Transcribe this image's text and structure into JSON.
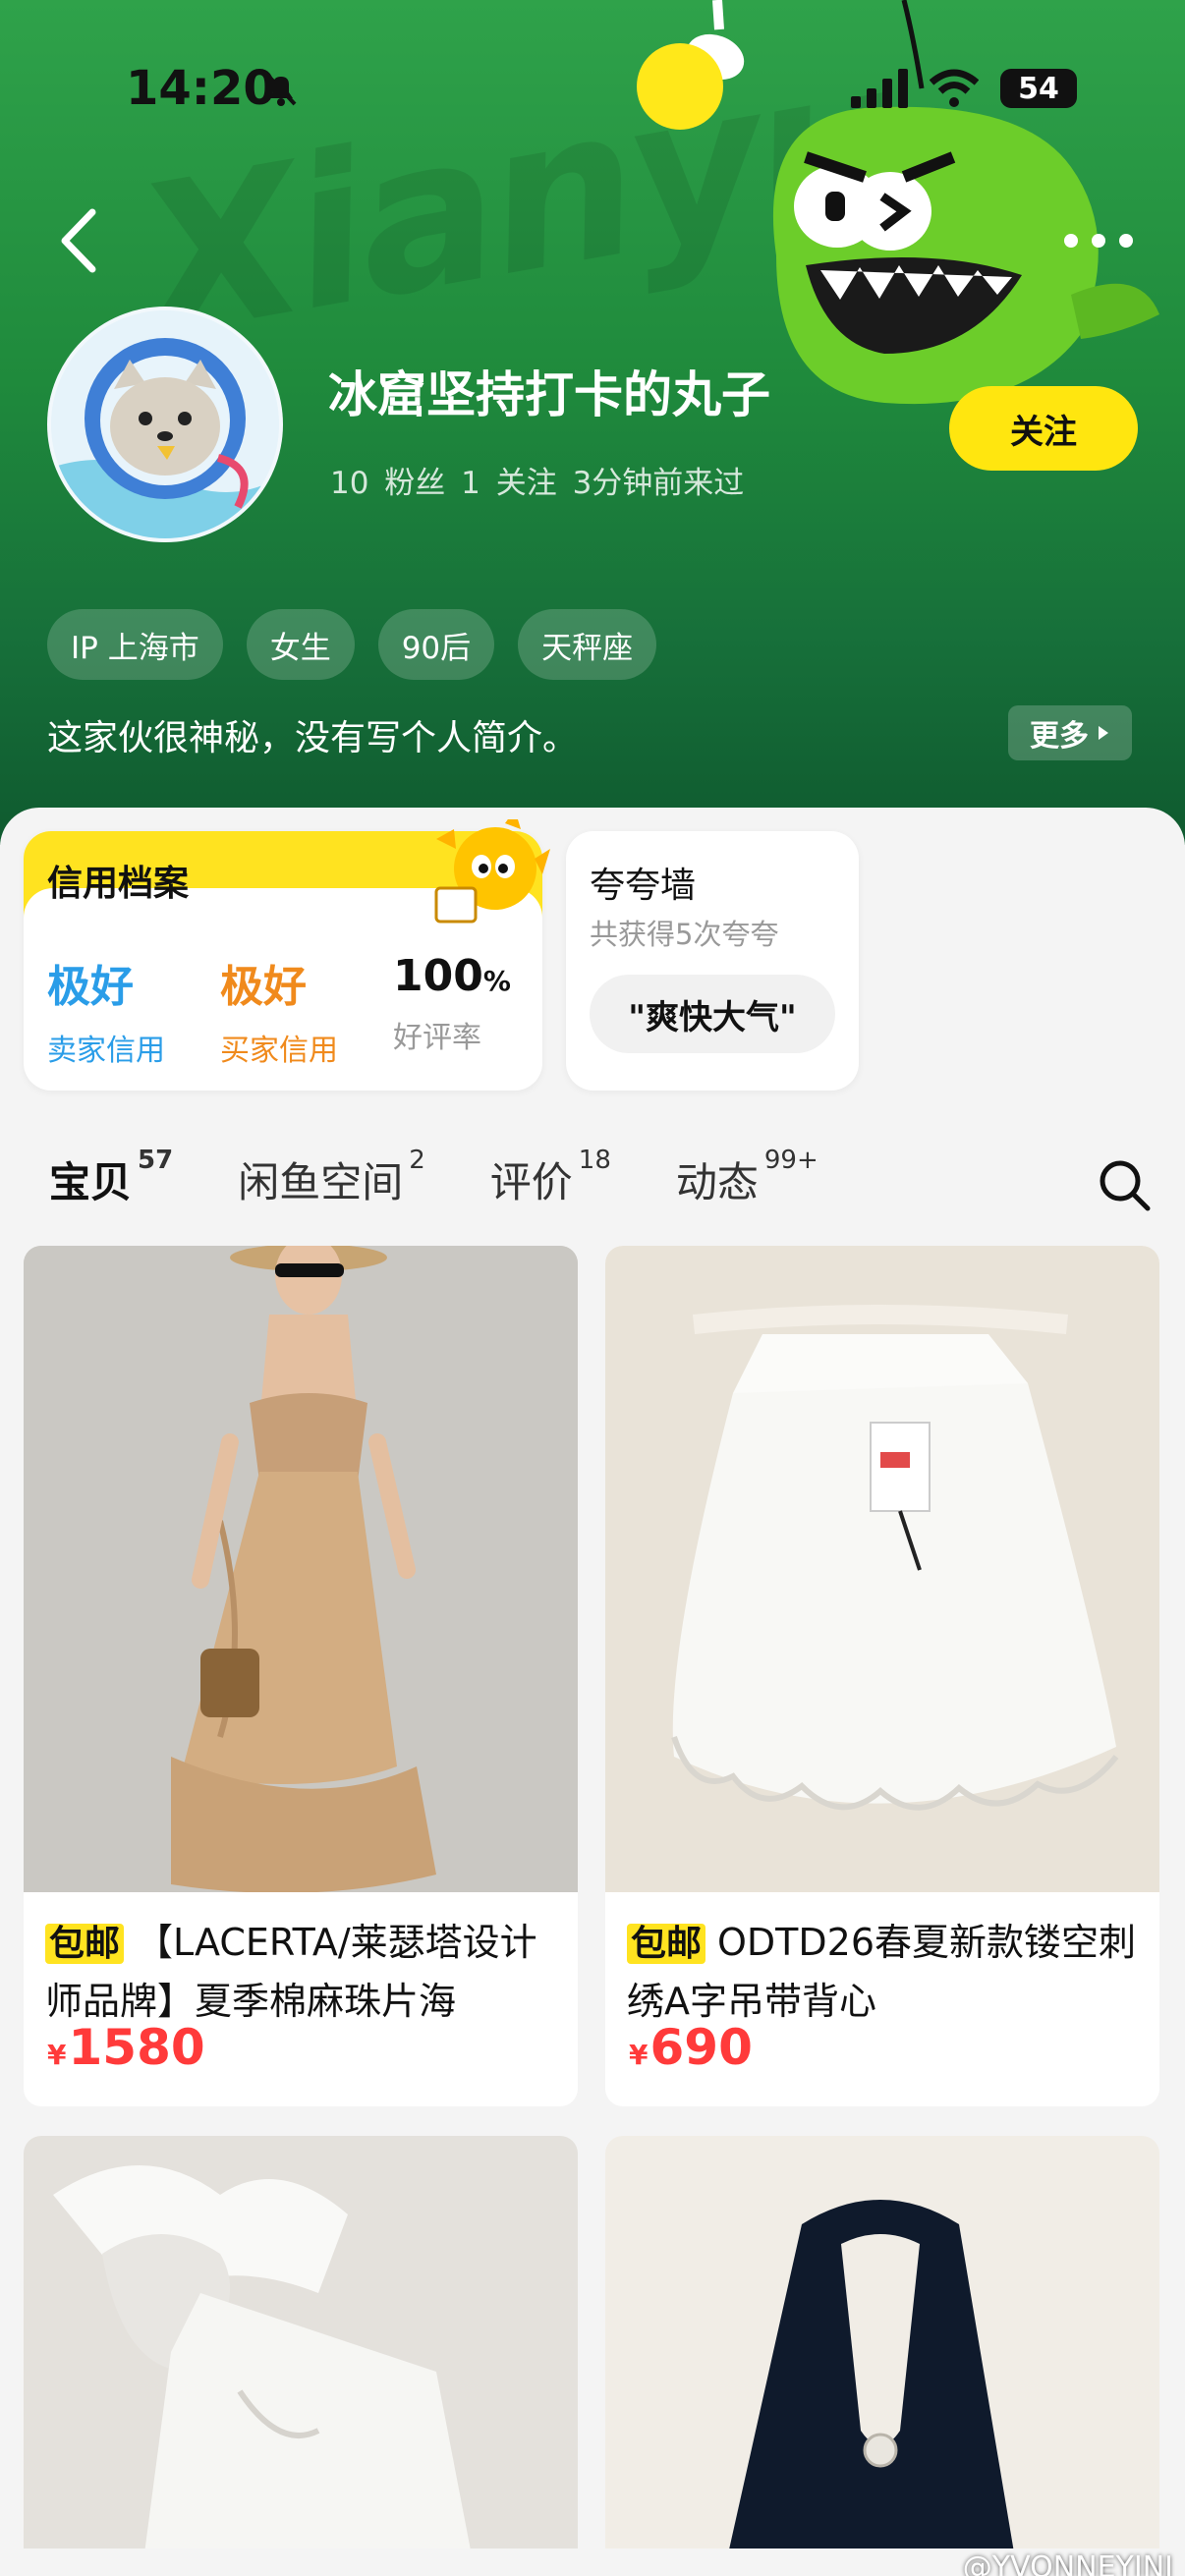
{
  "status": {
    "time": "14:20",
    "battery": "54"
  },
  "header": {
    "watermark": "Xianyu",
    "username": "冰窟坚持打卡的丸子",
    "stats": "10 粉丝   1 关注   3分钟前来过",
    "follow_label": "关注",
    "tags": [
      "IP 上海市",
      "女生",
      "90后",
      "天秤座"
    ],
    "bio": "这家伙很神秘，没有写个人简介。",
    "more_label": "更多"
  },
  "credit": {
    "title": "信用档案",
    "seller_value": "极好",
    "seller_label": "卖家信用",
    "buyer_value": "极好",
    "buyer_label": "买家信用",
    "rate_value": "100",
    "rate_unit": "%",
    "rate_label": "好评率"
  },
  "praise": {
    "title": "夸夸墙",
    "subtitle": "共获得5次夸夸",
    "chip": "\"爽快大气\""
  },
  "tabs": [
    {
      "label": "宝贝",
      "count": "57"
    },
    {
      "label": "闲鱼空间",
      "count": "2"
    },
    {
      "label": "评价",
      "count": "18"
    },
    {
      "label": "动态",
      "count": "99+"
    }
  ],
  "products": [
    {
      "badge": "包邮",
      "title": "【LACERTA/莱瑟塔设计师品牌】夏季棉麻珠片海",
      "currency": "¥",
      "price": "1580"
    },
    {
      "badge": "包邮",
      "title": "ODTD26春夏新款镂空刺绣A字吊带背心",
      "currency": "¥",
      "price": "690"
    }
  ],
  "watermark_credit": "@YVONNEYINJ",
  "colors": {
    "accent": "#ffe320",
    "price": "#ff3a3a",
    "seller": "#2a9de8",
    "buyer": "#f08a1c",
    "header": "#1f8a3c"
  }
}
